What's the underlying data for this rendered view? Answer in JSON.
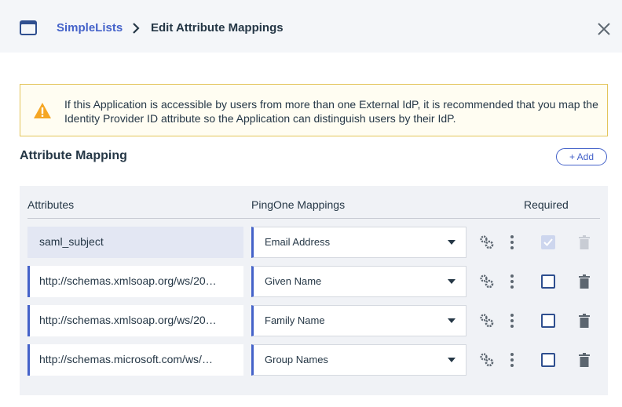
{
  "header": {
    "app_name": "SimpleLists",
    "page_title": "Edit Attribute Mappings"
  },
  "warning": {
    "text": "If this Application is accessible by users from more than one External IdP, it is recommended that you map the Identity Provider ID attribute so the Application can distinguish users by their IdP."
  },
  "section": {
    "title": "Attribute Mapping",
    "add_label": "+ Add"
  },
  "table": {
    "col_attributes": "Attributes",
    "col_mappings": "PingOne Mappings",
    "col_required": "Required",
    "rows": [
      {
        "attribute": "saml_subject",
        "mapping": "Email Address",
        "required": true,
        "readonly": true
      },
      {
        "attribute": "http://schemas.xmlsoap.org/ws/20…",
        "mapping": "Given Name",
        "required": false,
        "readonly": false
      },
      {
        "attribute": "http://schemas.xmlsoap.org/ws/20…",
        "mapping": "Family Name",
        "required": false,
        "readonly": false
      },
      {
        "attribute": "http://schemas.microsoft.com/ws/…",
        "mapping": "Group Names",
        "required": false,
        "readonly": false
      }
    ]
  },
  "icons": {
    "app": "app-window-icon",
    "breadcrumb_separator": "chevron-right-icon",
    "close": "close-icon",
    "warning": "warning-triangle-icon",
    "advanced": "gears-icon",
    "more": "kebab-menu-icon",
    "delete": "trash-icon",
    "dropdown": "caret-down-icon"
  },
  "colors": {
    "accent": "#4462c9",
    "warning_border": "#e3c55a",
    "warning_icon": "#f5a623"
  }
}
